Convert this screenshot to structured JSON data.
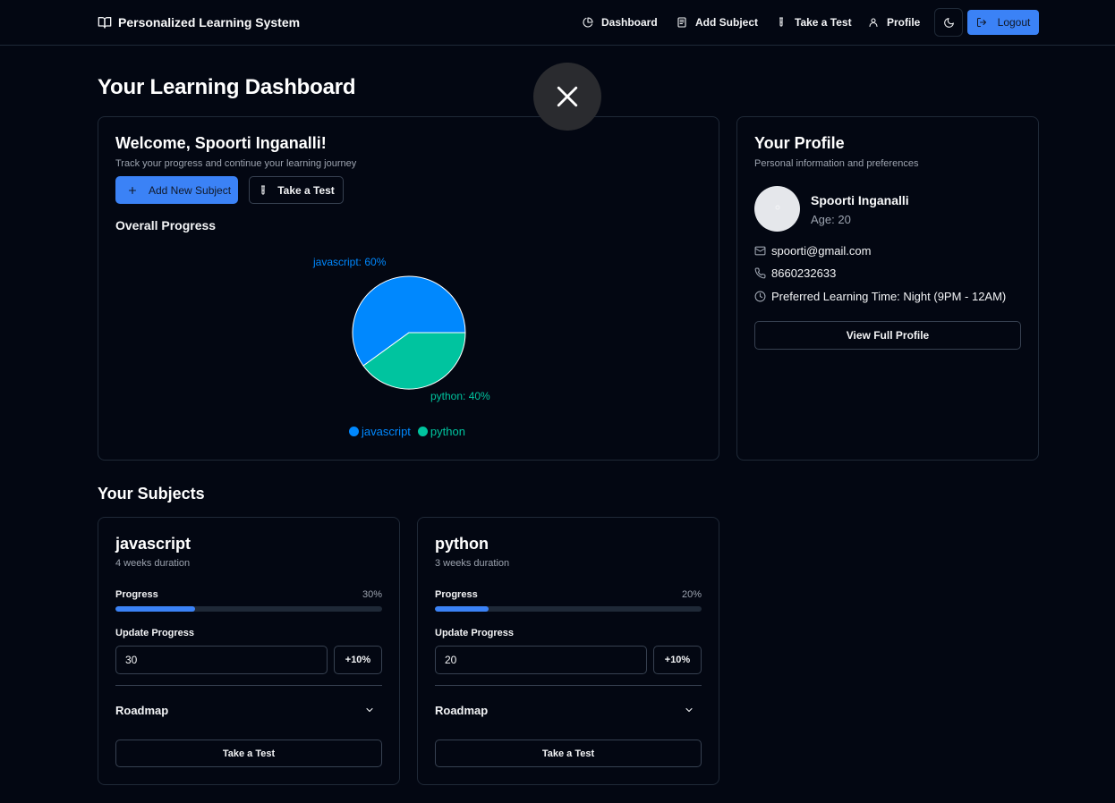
{
  "header": {
    "brand": "Personalized Learning System",
    "nav": [
      {
        "label": "Dashboard",
        "icon": "pie-chart-icon"
      },
      {
        "label": "Add Subject",
        "icon": "notebook-icon"
      },
      {
        "label": "Take a Test",
        "icon": "test-tube-icon"
      },
      {
        "label": "Profile",
        "icon": "user-icon"
      }
    ],
    "theme_toggle_icon": "moon-icon",
    "logout_label": "Logout"
  },
  "page_title": "Your Learning Dashboard",
  "welcome": {
    "heading": "Welcome, Spoorti Inganalli!",
    "subtitle": "Track your progress and continue your learning journey",
    "add_subject_label": "Add New Subject",
    "take_test_label": "Take a Test",
    "overall_progress_label": "Overall Progress"
  },
  "chart_data": {
    "type": "pie",
    "categories": [
      "javascript",
      "python"
    ],
    "values": [
      60,
      40
    ],
    "labels": [
      "javascript: 60%",
      "python: 40%"
    ],
    "colors": [
      "#0088FE",
      "#00C49F"
    ],
    "legend": "bottom"
  },
  "profile": {
    "heading": "Your Profile",
    "subtitle": "Personal information and preferences",
    "name": "Spoorti Inganalli",
    "age": "Age: 20",
    "email": "spoorti@gmail.com",
    "phone": "8660232633",
    "preferred_time": "Preferred Learning Time: Night (9PM - 12AM)",
    "view_full_label": "View Full Profile"
  },
  "subjects_title": "Your Subjects",
  "subjects": [
    {
      "name": "javascript",
      "duration": "4 weeks duration",
      "progress_label": "Progress",
      "progress_text": "30%",
      "progress": 30,
      "update_label": "Update Progress",
      "input_value": "30",
      "increment_label": "+10%",
      "roadmap_label": "Roadmap",
      "test_label": "Take a Test"
    },
    {
      "name": "python",
      "duration": "3 weeks duration",
      "progress_label": "Progress",
      "progress_text": "20%",
      "progress": 20,
      "update_label": "Update Progress",
      "input_value": "20",
      "increment_label": "+10%",
      "roadmap_label": "Roadmap",
      "test_label": "Take a Test"
    }
  ],
  "colors": {
    "background": "#030712",
    "accent": "#3b82f6",
    "border": "#1f2937"
  }
}
